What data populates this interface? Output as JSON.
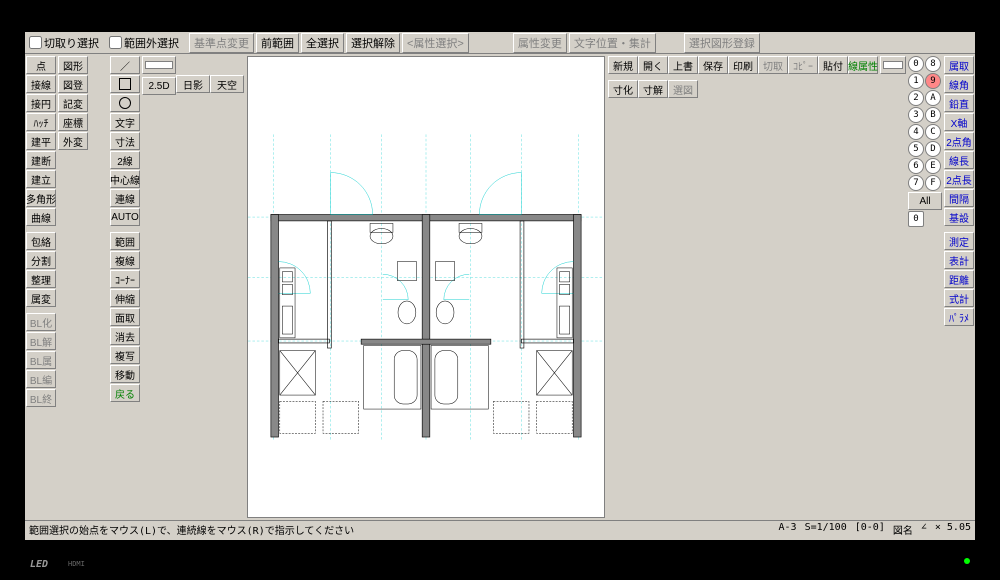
{
  "toolbar": {
    "cut_select_label": "切取り選択",
    "range_out_select_label": "範囲外選択",
    "base_point_change": "基準点変更",
    "prev_range": "前範囲",
    "all_select": "全選択",
    "select_clear": "選択解除",
    "attr_select": "<属性選択>",
    "attr_change": "属性変更",
    "text_pos_summary": "文字位置・集計",
    "select_fig_register": "選択図形登録"
  },
  "left_col1": [
    "点",
    "接線",
    "接円",
    "ﾊｯﾁ",
    "建平",
    "建断",
    "建立",
    "多角形",
    "曲線",
    "",
    "包絡",
    "分割",
    "整理",
    "属変",
    "",
    "BL化",
    "BL解",
    "BL属",
    "BL編",
    "BL終"
  ],
  "left_col2": [
    "図形",
    "図登",
    "記変",
    "座標",
    "外変"
  ],
  "left_col3_icons": [
    "slash",
    "square",
    "circle"
  ],
  "left_col3": [
    "文字",
    "寸法",
    "2線",
    "中心線",
    "連線",
    "AUTO",
    "",
    "範囲",
    "複線",
    "ｺｰﾅｰ",
    "伸縮",
    "面取",
    "消去",
    "複写",
    "移動",
    "戻る"
  ],
  "top_tool_col": [
    "2.5D",
    "日影",
    "天空"
  ],
  "right_file_col": [
    "新規",
    "開く",
    "上書",
    "保存",
    "印刷",
    "切取",
    "ｺﾋﾟｰ",
    "貼付",
    "線属性"
  ],
  "right_dim_col": [
    "寸化",
    "寸解",
    "選図"
  ],
  "right_attr_col": [
    "属取",
    "線角",
    "鉛直",
    "X軸",
    "2点角",
    "線長",
    "2点長",
    "間隔",
    "基設",
    "",
    "測定",
    "表計",
    "距離",
    "式計",
    "ﾊﾟﾗﾒ"
  ],
  "layers": {
    "left": [
      "0",
      "1",
      "2",
      "3",
      "4",
      "5",
      "6",
      "7",
      "All",
      "0"
    ],
    "right": [
      "8",
      "9",
      "A",
      "B",
      "C",
      "D",
      "E",
      "F"
    ]
  },
  "status": {
    "message": "範囲選択の始点をマウス(L)で、連続線をマウス(R)で指示してください",
    "layer_info": "A-3",
    "scale": "S=1/100",
    "sheet": "[0-0]",
    "sheet_name": "図名",
    "angle": "∠",
    "coord": "× 5.05"
  }
}
